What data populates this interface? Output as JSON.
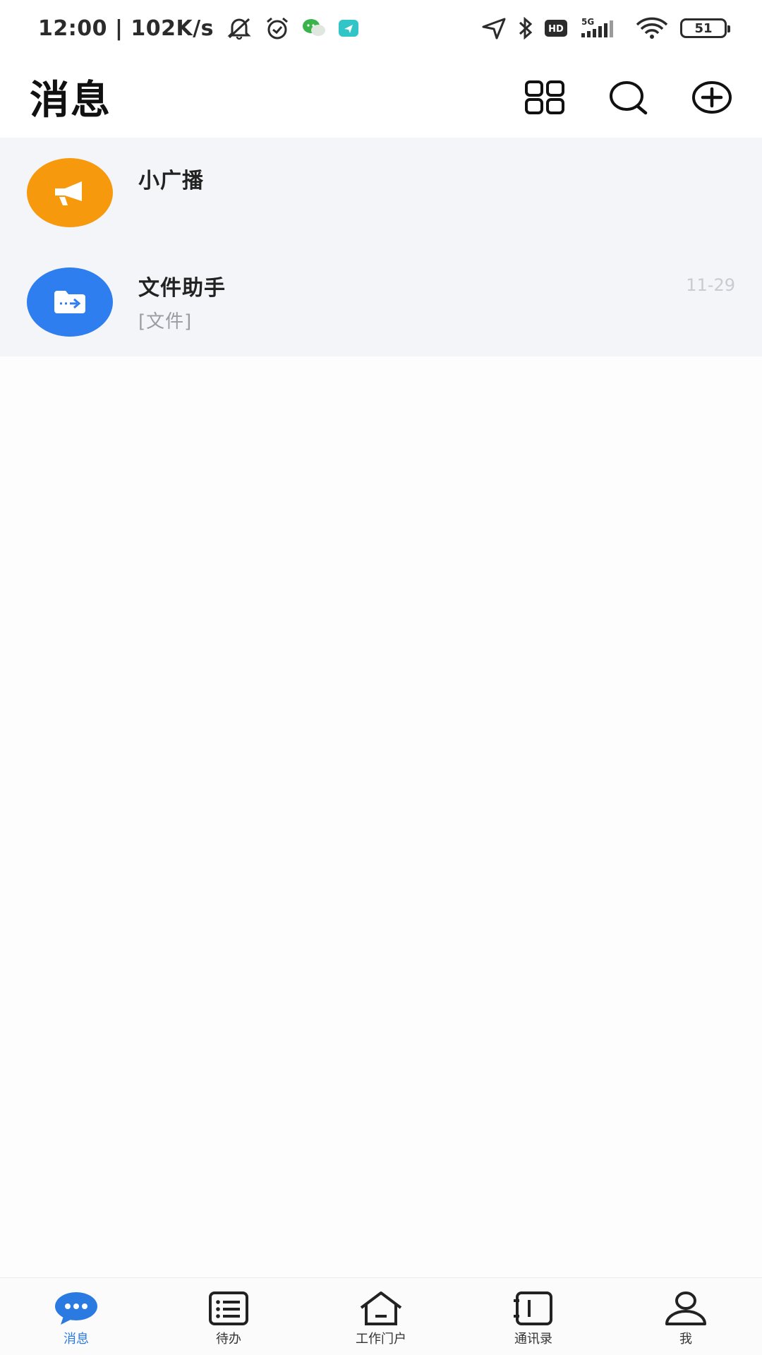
{
  "status_bar": {
    "time_speed": "12:00 | 102K/s",
    "network": "5G",
    "hd_label": "HD",
    "battery": "51"
  },
  "header": {
    "title": "消息"
  },
  "chats": [
    {
      "name": "小广播",
      "preview": "",
      "time": "",
      "avatar_color": "#f7990c",
      "icon": "megaphone-icon"
    },
    {
      "name": "文件助手",
      "preview": "[文件]",
      "time": "11-29",
      "avatar_color": "#2f7ef0",
      "icon": "folder-transfer-icon"
    }
  ],
  "bottom_nav": {
    "items": [
      {
        "label": "消息",
        "icon": "chat-bubble-icon",
        "active": true
      },
      {
        "label": "待办",
        "icon": "todo-list-icon",
        "active": false
      },
      {
        "label": "工作门户",
        "icon": "home-icon",
        "active": false
      },
      {
        "label": "通讯录",
        "icon": "contacts-book-icon",
        "active": false
      },
      {
        "label": "我",
        "icon": "person-icon",
        "active": false
      }
    ]
  },
  "colors": {
    "accent": "#2a7ae2",
    "broadcast": "#f7990c",
    "file_helper": "#2f7ef0"
  }
}
